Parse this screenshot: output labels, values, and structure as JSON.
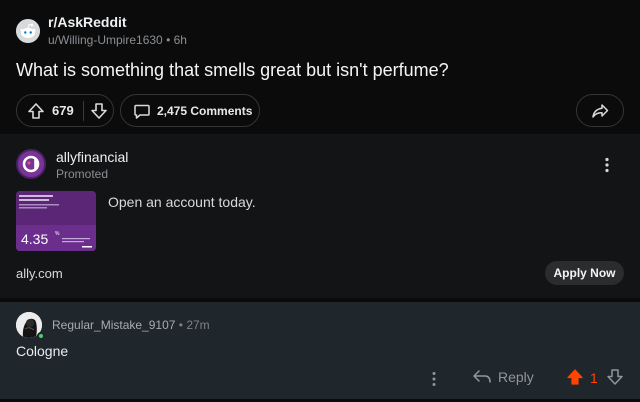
{
  "post": {
    "subreddit": "r/AskReddit",
    "author": "u/Willing-Umpire1630",
    "age": "6h",
    "meta_sep": "•",
    "title": "What is something that smells great but isn't perfume?",
    "score": "679",
    "comments_label": "2,475 Comments"
  },
  "ad": {
    "advertiser": "allyfinancial",
    "promoted_label": "Promoted",
    "headline": "Open an account today.",
    "domain": "ally.com",
    "cta_label": "Apply Now",
    "creative_rate": "4.35",
    "creative_rate_suffix": "%",
    "brand_color": "#6a2f8a"
  },
  "comment": {
    "author": "Regular_Mistake_9107",
    "age": "27m",
    "meta_sep": "•",
    "body": "Cologne",
    "reply_label": "Reply",
    "score": "1",
    "upvote_color": "#ff4500",
    "online": true
  },
  "icons": {
    "subreddit": "reddit-snoo-icon",
    "upvote": "arrow-up-icon",
    "downvote": "arrow-down-icon",
    "comments": "comment-bubble-icon",
    "share": "share-arrow-icon",
    "more": "more-vertical-icon",
    "reply": "reply-arrow-icon"
  }
}
